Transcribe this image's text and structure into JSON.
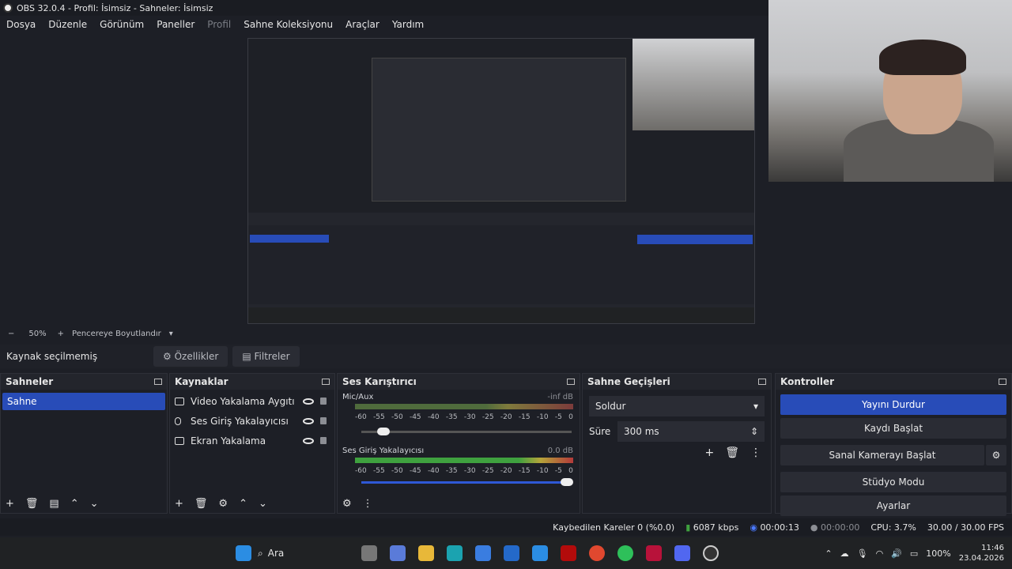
{
  "titlebar": {
    "title": "OBS 32.0.4 - Profil: İsimsiz - Sahneler: İsimsiz"
  },
  "menu": [
    "Dosya",
    "Düzenle",
    "Görünüm",
    "Paneller",
    "Profil",
    "Sahne Koleksiyonu",
    "Araçlar",
    "Yardım"
  ],
  "zoom": {
    "minus": "−",
    "level": "50%",
    "plus": "+",
    "fit": "Pencereye Boyutlandır"
  },
  "source_bar": {
    "label": "Kaynak seçilmemiş",
    "props": "Özellikler",
    "filters": "Filtreler"
  },
  "scenes": {
    "title": "Sahneler",
    "items": [
      "Sahne"
    ]
  },
  "sources": {
    "title": "Kaynaklar",
    "items": [
      "Video Yakalama Aygıtı",
      "Ses Giriş Yakalayıcısı",
      "Ekran Yakalama"
    ]
  },
  "mixer": {
    "title": "Ses Karıştırıcı",
    "channels": [
      {
        "name": "Mic/Aux",
        "db": "-inf dB"
      },
      {
        "name": "Ses Giriş Yakalayıcısı",
        "db": "0.0 dB"
      }
    ],
    "scale": [
      "-60",
      "-55",
      "-50",
      "-45",
      "-40",
      "-35",
      "-30",
      "-25",
      "-20",
      "-15",
      "-10",
      "-5",
      "0"
    ]
  },
  "transitions": {
    "title": "Sahne Geçişleri",
    "selected": "Soldur",
    "duration_label": "Süre",
    "duration": "300 ms"
  },
  "controls": {
    "title": "Kontroller",
    "buttons": [
      "Yayını Durdur",
      "Kaydı Başlat",
      "Sanal Kamerayı Başlat",
      "Stüdyo Modu",
      "Ayarlar"
    ]
  },
  "status": {
    "dropped": "Kaybedilen Kareler 0 (%0.0)",
    "kbps": "6087 kbps",
    "stream_time": "00:00:13",
    "rec_time": "00:00:00",
    "cpu": "CPU: 3.7%",
    "fps": "30.00 / 30.00 FPS"
  },
  "taskbar": {
    "search": "Ara",
    "battery": "100%",
    "time": "11:46",
    "date": "23.04.2026"
  }
}
